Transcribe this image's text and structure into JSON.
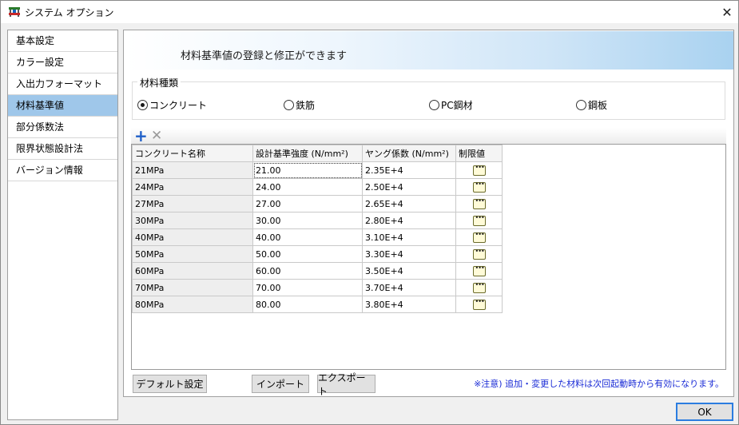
{
  "window": {
    "title": "システム オプション",
    "close": "✕"
  },
  "sidebar": {
    "items": [
      {
        "label": "基本設定"
      },
      {
        "label": "カラー設定"
      },
      {
        "label": "入出力フォーマット"
      },
      {
        "label": "材料基準値",
        "selected": true
      },
      {
        "label": "部分係数法"
      },
      {
        "label": "限界状態設計法"
      },
      {
        "label": "バージョン情報"
      }
    ]
  },
  "main": {
    "banner": "材料基準値の登録と修正ができます",
    "material_group": {
      "legend": "材料種類",
      "options": [
        {
          "label": "コンクリート",
          "checked": true
        },
        {
          "label": "鉄筋",
          "checked": false
        },
        {
          "label": "PC鋼材",
          "checked": false
        },
        {
          "label": "鋼板",
          "checked": false
        }
      ]
    },
    "toolbar": {
      "add": "+",
      "delete": "✕"
    },
    "table": {
      "headers": [
        "コンクリート名称",
        "設計基準強度 (N/mm²)",
        "ヤング係数 (N/mm²)",
        "制限値"
      ],
      "rows": [
        [
          "21MPa",
          "21.00",
          "2.35E+4"
        ],
        [
          "24MPa",
          "24.00",
          "2.50E+4"
        ],
        [
          "27MPa",
          "27.00",
          "2.65E+4"
        ],
        [
          "30MPa",
          "30.00",
          "2.80E+4"
        ],
        [
          "40MPa",
          "40.00",
          "3.10E+4"
        ],
        [
          "50MPa",
          "50.00",
          "3.30E+4"
        ],
        [
          "60MPa",
          "60.00",
          "3.50E+4"
        ],
        [
          "70MPa",
          "70.00",
          "3.70E+4"
        ],
        [
          "80MPa",
          "80.00",
          "3.80E+4"
        ]
      ]
    },
    "buttons": {
      "default": "デフォルト設定",
      "import": "インポート",
      "export": "エクスポート"
    },
    "note": "※注意) 追加・変更した材料は次回起動時から有効になります。"
  },
  "ok_label": "OK",
  "colors": {
    "selected_item": "#9fc7ea",
    "note_text": "#1a2bd6",
    "add_icon": "#1f5fc8"
  }
}
